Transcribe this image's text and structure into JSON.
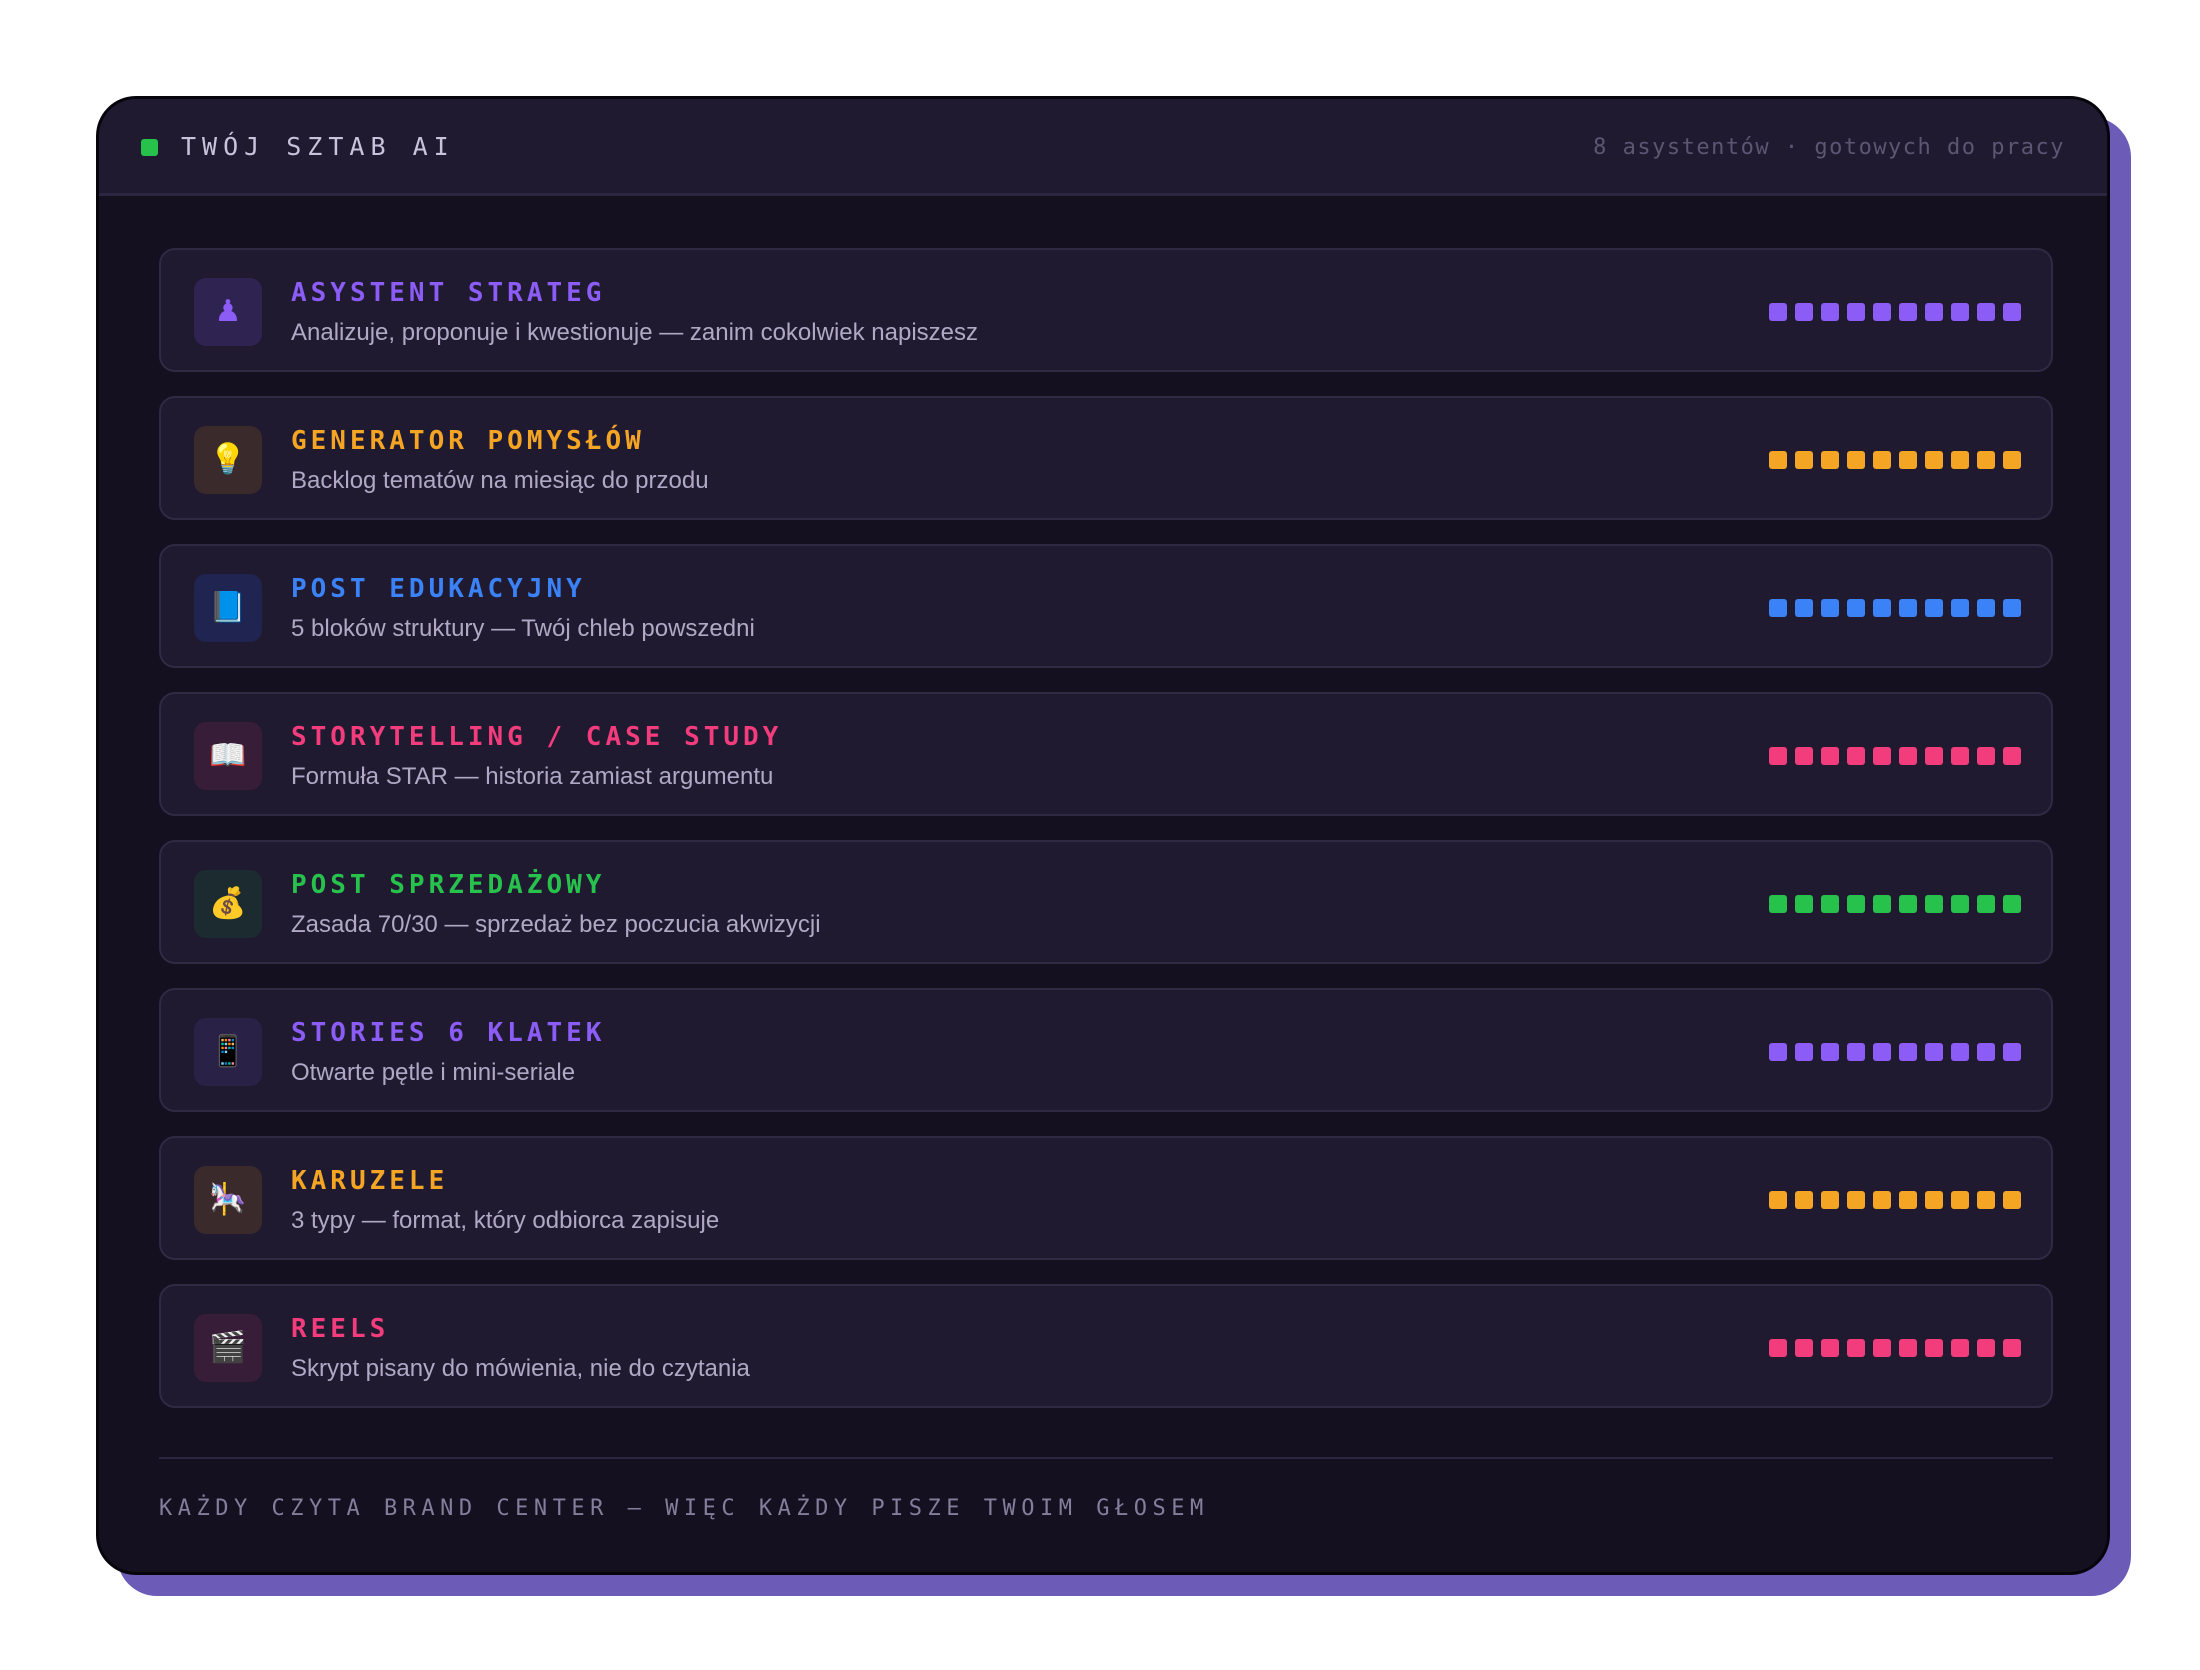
{
  "header": {
    "title": "TWÓJ SZTAB AI",
    "meta": "8 asystentów · gotowych do pracy",
    "status_color": "#27c24c"
  },
  "assistants": [
    {
      "title": "ASYSTENT STRATEG",
      "description": "Analizuje, proponuje i kwestionuje — zanim cokolwiek napiszesz",
      "icon": "chess-pawn-icon",
      "glyph": "♟",
      "color": "#8b5cf6",
      "icon_bg": "#2f2352",
      "level": 10,
      "max_level": 10
    },
    {
      "title": "GENERATOR POMYSŁÓW",
      "description": "Backlog tematów na miesiąc do przodu",
      "icon": "lightbulb-icon",
      "glyph": "💡",
      "color": "#f5a524",
      "icon_bg": "#3a2a2c",
      "level": 10,
      "max_level": 10
    },
    {
      "title": "POST EDUKACYJNY",
      "description": "5 bloków struktury — Twój chleb powszedni",
      "icon": "book-icon",
      "glyph": "📘",
      "color": "#3b82f6",
      "icon_bg": "#1f2550",
      "level": 10,
      "max_level": 10
    },
    {
      "title": "STORYTELLING / CASE STUDY",
      "description": "Formuła STAR — historia zamiast argumentu",
      "icon": "open-book-icon",
      "glyph": "📖",
      "color": "#f23c7c",
      "icon_bg": "#381d38",
      "level": 10,
      "max_level": 10
    },
    {
      "title": "POST SPRZEDAŻOWY",
      "description": "Zasada 70/30 — sprzedaż bez poczucia akwizycji",
      "icon": "money-bag-icon",
      "glyph": "💰",
      "color": "#27c24c",
      "icon_bg": "#1c2b2f",
      "level": 10,
      "max_level": 10
    },
    {
      "title": "STORIES 6 KLATEK",
      "description": "Otwarte pętle i mini-seriale",
      "icon": "mobile-phone-icon",
      "glyph": "📱",
      "color": "#8b5cf6",
      "icon_bg": "#2a2147",
      "level": 10,
      "max_level": 10
    },
    {
      "title": "KARUZELE",
      "description": "3 typy — format, który odbiorca zapisuje",
      "icon": "carousel-horse-icon",
      "glyph": "🎠",
      "color": "#f5a524",
      "icon_bg": "#3a2a2c",
      "level": 10,
      "max_level": 10
    },
    {
      "title": "REELS",
      "description": "Skrypt pisany do mówienia, nie do czytania",
      "icon": "clapperboard-icon",
      "glyph": "🎬",
      "color": "#f23c7c",
      "icon_bg": "#381d38",
      "level": 10,
      "max_level": 10
    }
  ],
  "footer": {
    "text": "KAŻDY CZYTA BRAND CENTER — WIĘC KAŻDY PISZE TWOIM GŁOSEM"
  }
}
